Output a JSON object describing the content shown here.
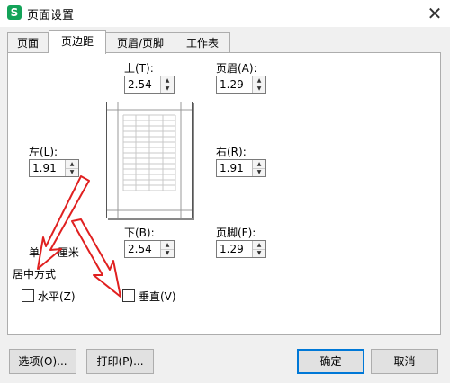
{
  "window": {
    "title": "页面设置",
    "app_icon_letter": "S",
    "close_glyph": "✕"
  },
  "tabs": [
    {
      "label": "页面",
      "active": false
    },
    {
      "label": "页边距",
      "active": true
    },
    {
      "label": "页眉/页脚",
      "active": false
    },
    {
      "label": "工作表",
      "active": false
    }
  ],
  "margins": {
    "top": {
      "label": "上(T):",
      "value": "2.54"
    },
    "header": {
      "label": "页眉(A):",
      "value": "1.29"
    },
    "left": {
      "label": "左(L):",
      "value": "1.91"
    },
    "right": {
      "label": "右(R):",
      "value": "1.91"
    },
    "bottom": {
      "label": "下(B):",
      "value": "2.54"
    },
    "footer": {
      "label": "页脚(F):",
      "value": "1.29"
    }
  },
  "unit": {
    "label": "单位: 厘米"
  },
  "centering": {
    "group_label": "居中方式",
    "horizontal": {
      "label": "水平(Z)",
      "checked": false
    },
    "vertical": {
      "label": "垂直(V)",
      "checked": false
    }
  },
  "buttons": {
    "options": "选项(O)...",
    "print": "打印(P)...",
    "ok": "确定",
    "cancel": "取消"
  },
  "colors": {
    "annotation_arrow": "#e02020",
    "accent": "#0078d7",
    "app_icon": "#14a359"
  }
}
